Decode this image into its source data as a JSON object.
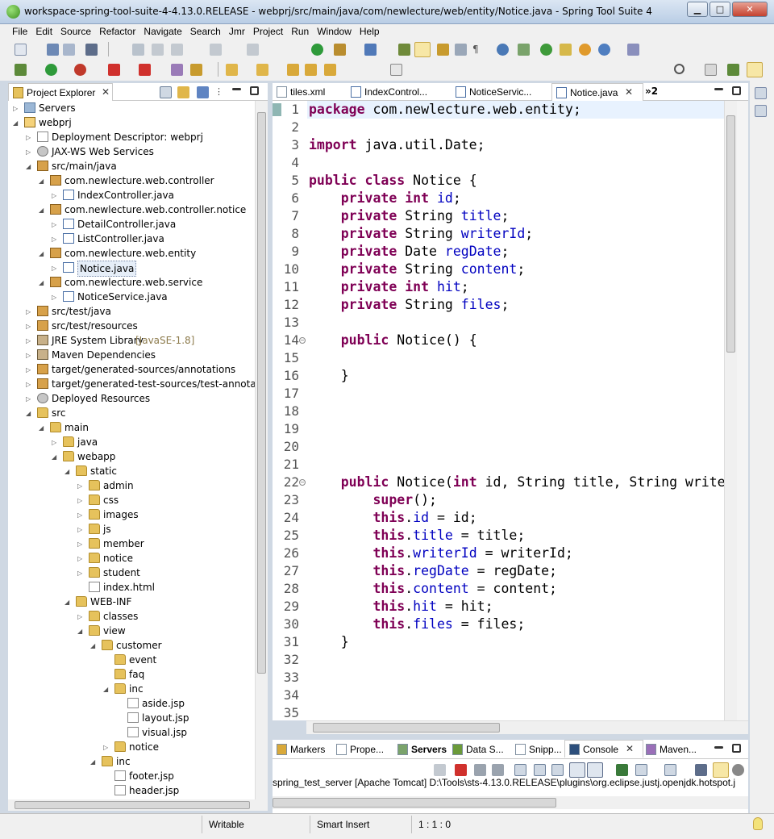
{
  "window": {
    "title": "workspace-spring-tool-suite-4-4.13.0.RELEASE - webprj/src/main/java/com/newlecture/web/entity/Notice.java - Spring Tool Suite 4",
    "minimize": "▁",
    "maximize": "□",
    "close": "✕"
  },
  "menu": [
    "File",
    "Edit",
    "Source",
    "Refactor",
    "Navigate",
    "Search",
    "Jmr",
    "Project",
    "Run",
    "Window",
    "Help"
  ],
  "explorer": {
    "title": "Project Explorer",
    "items": [
      {
        "label": "Servers",
        "icon": "servers-folder-icon"
      },
      {
        "label": "webprj",
        "icon": "web-project-icon"
      },
      {
        "label": "Deployment Descriptor: webprj",
        "icon": "deployment-descriptor-icon"
      },
      {
        "label": "JAX-WS Web Services",
        "icon": "web-services-icon"
      },
      {
        "label": "src/main/java",
        "icon": "source-folder-icon"
      },
      {
        "label": "com.newlecture.web.controller",
        "icon": "package-icon"
      },
      {
        "label": "IndexController.java",
        "icon": "java-file-icon"
      },
      {
        "label": "com.newlecture.web.controller.notice",
        "icon": "package-icon"
      },
      {
        "label": "DetailController.java",
        "icon": "java-file-icon"
      },
      {
        "label": "ListController.java",
        "icon": "java-file-icon"
      },
      {
        "label": "com.newlecture.web.entity",
        "icon": "package-icon"
      },
      {
        "label": "Notice.java",
        "icon": "java-file-icon"
      },
      {
        "label": "com.newlecture.web.service",
        "icon": "package-icon"
      },
      {
        "label": "NoticeService.java",
        "icon": "java-file-icon"
      },
      {
        "label": "src/test/java",
        "icon": "source-folder-icon"
      },
      {
        "label": "src/test/resources",
        "icon": "source-folder-icon"
      },
      {
        "label": "JRE System Library",
        "extra": "[JavaSE-1.8]",
        "icon": "library-icon"
      },
      {
        "label": "Maven Dependencies",
        "icon": "library-icon"
      },
      {
        "label": "target/generated-sources/annotations",
        "icon": "source-folder-icon"
      },
      {
        "label": "target/generated-test-sources/test-annotations",
        "icon": "source-folder-icon"
      },
      {
        "label": "Deployed Resources",
        "icon": "deployed-resources-icon"
      },
      {
        "label": "src",
        "icon": "folder-icon"
      },
      {
        "label": "main",
        "icon": "folder-icon"
      },
      {
        "label": "java",
        "icon": "folder-icon"
      },
      {
        "label": "webapp",
        "icon": "folder-icon"
      },
      {
        "label": "static",
        "icon": "folder-icon"
      },
      {
        "label": "admin",
        "icon": "folder-icon"
      },
      {
        "label": "css",
        "icon": "folder-icon"
      },
      {
        "label": "images",
        "icon": "folder-icon"
      },
      {
        "label": "js",
        "icon": "folder-icon"
      },
      {
        "label": "member",
        "icon": "folder-icon"
      },
      {
        "label": "notice",
        "icon": "folder-icon"
      },
      {
        "label": "student",
        "icon": "folder-icon"
      },
      {
        "label": "index.html",
        "icon": "html-file-icon"
      },
      {
        "label": "WEB-INF",
        "icon": "folder-icon"
      },
      {
        "label": "classes",
        "icon": "folder-icon"
      },
      {
        "label": "view",
        "icon": "folder-icon"
      },
      {
        "label": "customer",
        "icon": "folder-icon"
      },
      {
        "label": "event",
        "icon": "folder-icon"
      },
      {
        "label": "faq",
        "icon": "folder-icon"
      },
      {
        "label": "inc",
        "icon": "folder-icon"
      },
      {
        "label": "aside.jsp",
        "icon": "jsp-file-icon"
      },
      {
        "label": "layout.jsp",
        "icon": "jsp-file-icon"
      },
      {
        "label": "visual.jsp",
        "icon": "jsp-file-icon"
      },
      {
        "label": "notice",
        "icon": "folder-icon"
      },
      {
        "label": "inc",
        "icon": "folder-icon"
      },
      {
        "label": "footer.jsp",
        "icon": "jsp-file-icon"
      },
      {
        "label": "header.jsp",
        "icon": "jsp-file-icon"
      }
    ]
  },
  "editor": {
    "tabs": [
      "tiles.xml",
      "IndexControl...",
      "NoticeServic...",
      "Notice.java"
    ],
    "overflow_tab": "»2",
    "lines": [
      {
        "n": "1",
        "tokens": [
          {
            "t": "package",
            "c": "kw"
          },
          {
            "t": " com.newlecture.web.entity;"
          }
        ]
      },
      {
        "n": "2",
        "tokens": []
      },
      {
        "n": "3",
        "tokens": [
          {
            "t": "import",
            "c": "kw"
          },
          {
            "t": " java.util.Date;"
          }
        ]
      },
      {
        "n": "4",
        "tokens": []
      },
      {
        "n": "5",
        "tokens": [
          {
            "t": "public",
            "c": "kw"
          },
          {
            "t": " "
          },
          {
            "t": "class",
            "c": "kw"
          },
          {
            "t": " Notice {"
          }
        ]
      },
      {
        "n": "6",
        "tokens": [
          {
            "t": "    "
          },
          {
            "t": "private",
            "c": "kw"
          },
          {
            "t": " "
          },
          {
            "t": "int",
            "c": "kw"
          },
          {
            "t": " "
          },
          {
            "t": "id",
            "c": "fld"
          },
          {
            "t": ";"
          }
        ]
      },
      {
        "n": "7",
        "tokens": [
          {
            "t": "    "
          },
          {
            "t": "private",
            "c": "kw"
          },
          {
            "t": " String "
          },
          {
            "t": "title",
            "c": "fld"
          },
          {
            "t": ";"
          }
        ]
      },
      {
        "n": "8",
        "tokens": [
          {
            "t": "    "
          },
          {
            "t": "private",
            "c": "kw"
          },
          {
            "t": " String "
          },
          {
            "t": "writerId",
            "c": "fld"
          },
          {
            "t": ";"
          }
        ]
      },
      {
        "n": "9",
        "tokens": [
          {
            "t": "    "
          },
          {
            "t": "private",
            "c": "kw"
          },
          {
            "t": " Date "
          },
          {
            "t": "regDate",
            "c": "fld"
          },
          {
            "t": ";"
          }
        ]
      },
      {
        "n": "10",
        "tokens": [
          {
            "t": "    "
          },
          {
            "t": "private",
            "c": "kw"
          },
          {
            "t": " String "
          },
          {
            "t": "content",
            "c": "fld"
          },
          {
            "t": ";"
          }
        ]
      },
      {
        "n": "11",
        "tokens": [
          {
            "t": "    "
          },
          {
            "t": "private",
            "c": "kw"
          },
          {
            "t": " "
          },
          {
            "t": "int",
            "c": "kw"
          },
          {
            "t": " "
          },
          {
            "t": "hit",
            "c": "fld"
          },
          {
            "t": ";"
          }
        ]
      },
      {
        "n": "12",
        "tokens": [
          {
            "t": "    "
          },
          {
            "t": "private",
            "c": "kw"
          },
          {
            "t": " String "
          },
          {
            "t": "files",
            "c": "fld"
          },
          {
            "t": ";"
          }
        ]
      },
      {
        "n": "13",
        "tokens": []
      },
      {
        "n": "14",
        "fold": true,
        "tokens": [
          {
            "t": "    "
          },
          {
            "t": "public",
            "c": "kw"
          },
          {
            "t": " Notice() {"
          }
        ]
      },
      {
        "n": "15",
        "tokens": []
      },
      {
        "n": "16",
        "tokens": [
          {
            "t": "    }"
          }
        ]
      },
      {
        "n": "17",
        "tokens": []
      },
      {
        "n": "18",
        "tokens": []
      },
      {
        "n": "19",
        "tokens": []
      },
      {
        "n": "20",
        "tokens": []
      },
      {
        "n": "21",
        "tokens": []
      },
      {
        "n": "22",
        "fold": true,
        "tokens": [
          {
            "t": "    "
          },
          {
            "t": "public",
            "c": "kw"
          },
          {
            "t": " Notice("
          },
          {
            "t": "int",
            "c": "kw"
          },
          {
            "t": " id, String title, String write"
          }
        ]
      },
      {
        "n": "23",
        "tokens": [
          {
            "t": "        "
          },
          {
            "t": "super",
            "c": "kw"
          },
          {
            "t": "();"
          }
        ]
      },
      {
        "n": "24",
        "tokens": [
          {
            "t": "        "
          },
          {
            "t": "this",
            "c": "kw"
          },
          {
            "t": "."
          },
          {
            "t": "id",
            "c": "fld"
          },
          {
            "t": " = id;"
          }
        ]
      },
      {
        "n": "25",
        "tokens": [
          {
            "t": "        "
          },
          {
            "t": "this",
            "c": "kw"
          },
          {
            "t": "."
          },
          {
            "t": "title",
            "c": "fld"
          },
          {
            "t": " = title;"
          }
        ]
      },
      {
        "n": "26",
        "tokens": [
          {
            "t": "        "
          },
          {
            "t": "this",
            "c": "kw"
          },
          {
            "t": "."
          },
          {
            "t": "writerId",
            "c": "fld"
          },
          {
            "t": " = writerId;"
          }
        ]
      },
      {
        "n": "27",
        "tokens": [
          {
            "t": "        "
          },
          {
            "t": "this",
            "c": "kw"
          },
          {
            "t": "."
          },
          {
            "t": "regDate",
            "c": "fld"
          },
          {
            "t": " = regDate;"
          }
        ]
      },
      {
        "n": "28",
        "tokens": [
          {
            "t": "        "
          },
          {
            "t": "this",
            "c": "kw"
          },
          {
            "t": "."
          },
          {
            "t": "content",
            "c": "fld"
          },
          {
            "t": " = content;"
          }
        ]
      },
      {
        "n": "29",
        "tokens": [
          {
            "t": "        "
          },
          {
            "t": "this",
            "c": "kw"
          },
          {
            "t": "."
          },
          {
            "t": "hit",
            "c": "fld"
          },
          {
            "t": " = hit;"
          }
        ]
      },
      {
        "n": "30",
        "tokens": [
          {
            "t": "        "
          },
          {
            "t": "this",
            "c": "kw"
          },
          {
            "t": "."
          },
          {
            "t": "files",
            "c": "fld"
          },
          {
            "t": " = files;"
          }
        ]
      },
      {
        "n": "31",
        "tokens": [
          {
            "t": "    }"
          }
        ]
      },
      {
        "n": "32",
        "tokens": []
      },
      {
        "n": "33",
        "tokens": []
      },
      {
        "n": "34",
        "tokens": []
      },
      {
        "n": "35",
        "tokens": []
      }
    ]
  },
  "bottom_panel": {
    "tabs": [
      "Markers",
      "Prope...",
      "Servers",
      "Data S...",
      "Snipp...",
      "Console",
      "Maven..."
    ],
    "console_line": "spring_test_server [Apache Tomcat] D:\\Tools\\sts-4.13.0.RELEASE\\plugins\\org.eclipse.justj.openjdk.hotspot.j"
  },
  "status": {
    "writable": "Writable",
    "insert_mode": "Smart Insert",
    "position": "1 : 1 : 0"
  },
  "colors": {
    "keyword": "#7f0055",
    "field": "#0000c0",
    "current_line": "#e8f2fe"
  }
}
